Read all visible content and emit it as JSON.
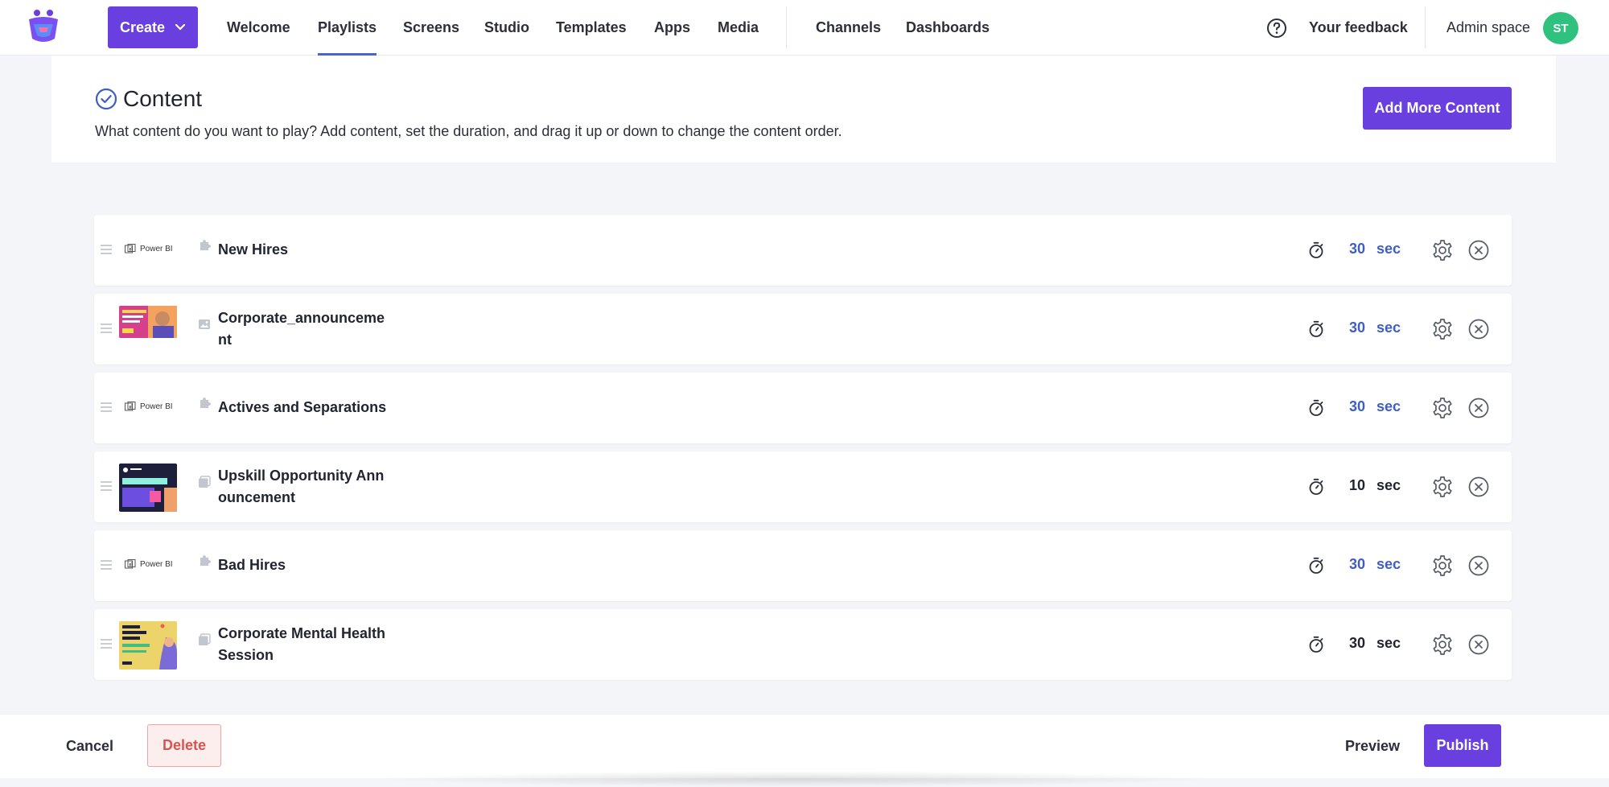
{
  "nav": {
    "create_label": "Create",
    "items": [
      "Welcome",
      "Playlists",
      "Screens",
      "Studio",
      "Templates",
      "Apps",
      "Media"
    ],
    "secondary_items": [
      "Channels",
      "Dashboards"
    ],
    "active": "Playlists",
    "feedback_label": "Your feedback",
    "space_label": "Admin space",
    "avatar_initials": "ST"
  },
  "content": {
    "title": "Content",
    "subtitle": "What content do you want to play? Add content, set the duration, and drag it up or down to change the content order.",
    "add_button": "Add More Content",
    "items": [
      {
        "title": "New Hires",
        "thumb": "Power BI",
        "type_icon": "puzzle-icon",
        "duration": "30",
        "unit": "sec"
      },
      {
        "title": "Corporate_announcement",
        "thumb": "image",
        "type_icon": "image-icon",
        "duration": "30",
        "unit": "sec"
      },
      {
        "title": "Actives and Separations",
        "thumb": "Power BI",
        "type_icon": "puzzle-icon",
        "duration": "30",
        "unit": "sec"
      },
      {
        "title": "Upskill Opportunity Announcement",
        "thumb": "image",
        "type_icon": "template-icon",
        "duration": "10",
        "unit": "sec"
      },
      {
        "title": "Bad Hires",
        "thumb": "Power BI",
        "type_icon": "puzzle-icon",
        "duration": "30",
        "unit": "sec"
      },
      {
        "title": "Corporate Mental Health Session",
        "thumb": "image",
        "type_icon": "template-icon",
        "duration": "30",
        "unit": "sec"
      }
    ]
  },
  "footer": {
    "cancel": "Cancel",
    "delete": "Delete",
    "preview": "Preview",
    "publish": "Publish"
  },
  "colors": {
    "primary": "#6a3fe0",
    "duration_blue": "#3f5ec4",
    "avatar": "#2ec27e",
    "delete_text": "#d9534f"
  }
}
